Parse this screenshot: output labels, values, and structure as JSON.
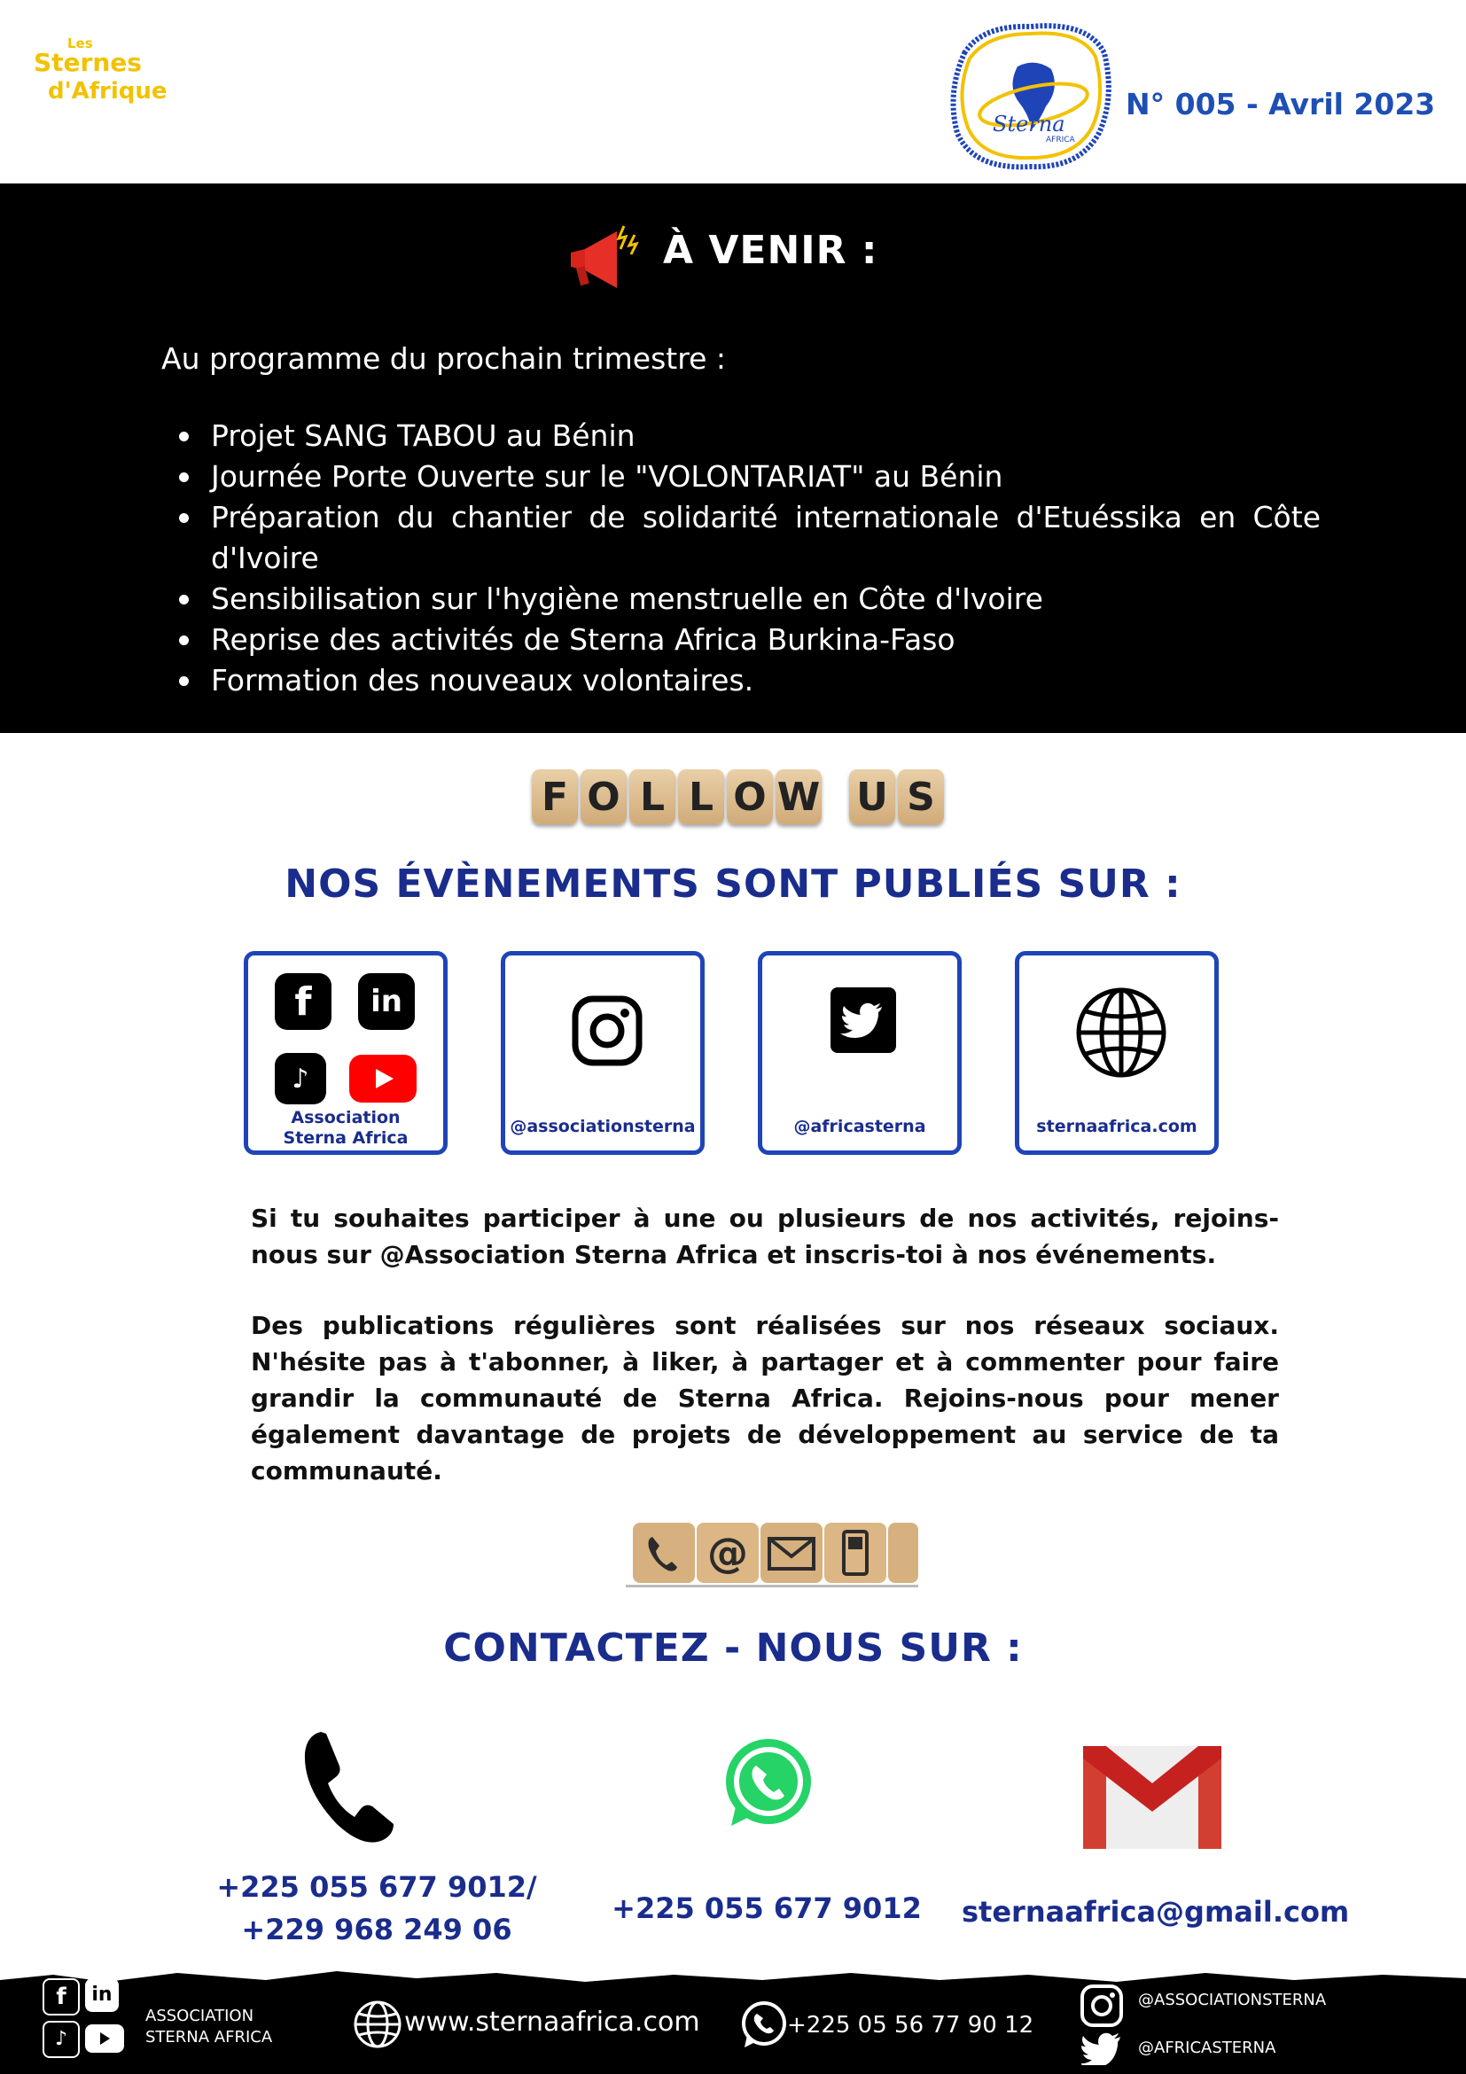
{
  "header": {
    "brand": {
      "line1": "Les",
      "line2": "Sternes",
      "line3": "d'Afrique"
    },
    "emblem_text": "Sterna",
    "emblem_subtext": "AFRICA",
    "issue": "N° 005 - Avril 2023"
  },
  "upcoming": {
    "title": "À VENIR :",
    "intro": "Au programme du prochain trimestre :",
    "items": [
      "Projet SANG TABOU au Bénin",
      "Journée Porte Ouverte sur le \"VOLONTARIAT\" au Bénin",
      "Préparation du chantier de solidarité internationale d'Etuéssika en Côte d'Ivoire",
      "Sensibilisation sur l'hygiène menstruelle en Côte d'Ivoire",
      "Reprise des activités de Sterna Africa Burkina-Faso",
      "Formation des nouveaux volontaires."
    ]
  },
  "follow": {
    "tiles_word1": [
      "F",
      "O",
      "L",
      "L",
      "O",
      "W"
    ],
    "tiles_word2": [
      "U",
      "S"
    ],
    "heading": "NOS ÉVÈNEMENTS SONT PUBLIÉS SUR :"
  },
  "social_cards": [
    {
      "caption_line1": "Association",
      "caption_line2": "Sterna Africa",
      "icons": [
        "facebook-icon",
        "linkedin-icon",
        "tiktok-icon",
        "youtube-icon"
      ]
    },
    {
      "caption": "@associationsterna",
      "icon": "instagram-icon"
    },
    {
      "caption": "@africasterna",
      "icon": "twitter-icon"
    },
    {
      "caption": "sternaafrica.com",
      "icon": "globe-icon"
    }
  ],
  "paragraphs": {
    "p1": "Si tu souhaites participer à une ou plusieurs de nos activités, rejoins-nous sur @Association Sterna Africa et inscris-toi à nos événements.",
    "p2": "Des publications régulières sont réalisées sur nos réseaux sociaux. N'hésite pas à t'abonner, à liker, à partager et à commenter pour faire grandir la communauté de Sterna Africa. Rejoins-nous pour mener également davantage de projets de développement au service de ta communauté."
  },
  "contact": {
    "heading": "CONTACTEZ - NOUS SUR :",
    "phone_line1": "+225 055 677 9012/",
    "phone_line2": "+229 968 249 06",
    "whatsapp": "+225 055 677 9012",
    "email": "sternaafrica@gmail.com"
  },
  "footer": {
    "org_line1": "ASSOCIATION",
    "org_line2": "STERNA AFRICA",
    "website": "www.sternaafrica.com",
    "whatsapp": "+225 05 56 77 90 12",
    "instagram": "@ASSOCIATIONSTERNA",
    "twitter": "@AFRICASTERNA"
  },
  "colors": {
    "accent_blue": "#1a2d8c",
    "brand_yellow": "#f2c200",
    "band_black": "#000000"
  }
}
